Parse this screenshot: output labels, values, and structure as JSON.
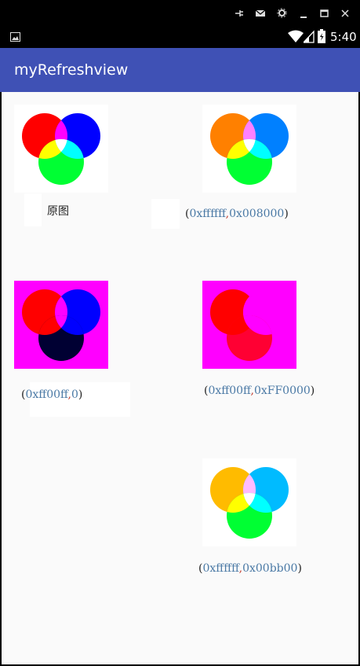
{
  "statusbar": {
    "time": "5:40"
  },
  "appbar": {
    "title": "myRefreshview"
  },
  "tiles": [
    {
      "id": "original",
      "bg": "#ffffff",
      "red": "#ff0000",
      "blue": "#0000ff",
      "green": "#00ff33",
      "overlay_rb": "#ff00ff",
      "overlay_rg": "#ffff00",
      "overlay_bg": "#00ffff",
      "center": "#ffffff"
    },
    {
      "id": "mul_0x008000",
      "bg": "#ffffff",
      "red": "#ff8000",
      "blue": "#0080ff",
      "green": "#00ff33",
      "overlay_rb": "#ff80ff",
      "overlay_rg": "#ffff00",
      "overlay_bg": "#00ffff",
      "center": "#ffffff"
    },
    {
      "id": "mul_0xff00ff_0",
      "bg": "#ff00ff",
      "red": "#ff0000",
      "blue": "#0000ff",
      "green": "#000033",
      "overlay_rb": "#ff00ff",
      "overlay_rg": "#ff0000",
      "overlay_bg": "#0000ff",
      "center": "#ff00ff"
    },
    {
      "id": "mul_0xff00ff_0xFF0000",
      "bg": "#ff00ff",
      "red": "#ff0000",
      "blue": "#ff00ff",
      "green": "#ff0033",
      "overlay_rb": "#ff00ff",
      "overlay_rg": "#ff0000",
      "overlay_bg": "#ff00ff",
      "center": "#ff00ff"
    },
    {
      "id": "mul_0x00bb00",
      "bg": "#ffffff",
      "red": "#ffbb00",
      "blue": "#00bbff",
      "green": "#00ff33",
      "overlay_rb": "#ffbbff",
      "overlay_rg": "#ffff00",
      "overlay_bg": "#00ffff",
      "center": "#ffffff"
    }
  ],
  "labels": {
    "original": "原图",
    "l1_open": "(",
    "l1_a": "0xffffff",
    "l1_comma": ",",
    "l1_b": "0x008000",
    "l1_close": ")",
    "l2_open": "(",
    "l2_a": "0xff00ff",
    "l2_comma": ",",
    "l2_b": "0",
    "l2_close": ")",
    "l3_open": "(",
    "l3_a": "0xff00ff",
    "l3_comma": ",",
    "l3_b": "0xFF0000",
    "l3_close": ")",
    "l4_open": "(",
    "l4_a": "0xffffff",
    "l4_comma": ",",
    "l4_b": "0x00bb00",
    "l4_close": ")"
  }
}
